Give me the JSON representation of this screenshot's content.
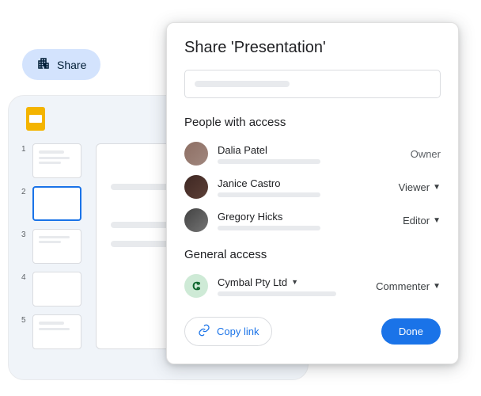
{
  "shareChip": {
    "label": "Share"
  },
  "modal": {
    "title": "Share 'Presentation'",
    "sectionPeople": "People with access",
    "sectionGeneral": "General access",
    "people": [
      {
        "name": "Dalia Patel",
        "role": "Owner"
      },
      {
        "name": "Janice Castro",
        "role": "Viewer"
      },
      {
        "name": "Gregory Hicks",
        "role": "Editor"
      }
    ],
    "general": {
      "org": "Cymbal Pty Ltd",
      "role": "Commenter"
    },
    "copyLink": "Copy link",
    "done": "Done"
  },
  "slides": {
    "thumbs": [
      "1",
      "2",
      "3",
      "4",
      "5"
    ]
  }
}
